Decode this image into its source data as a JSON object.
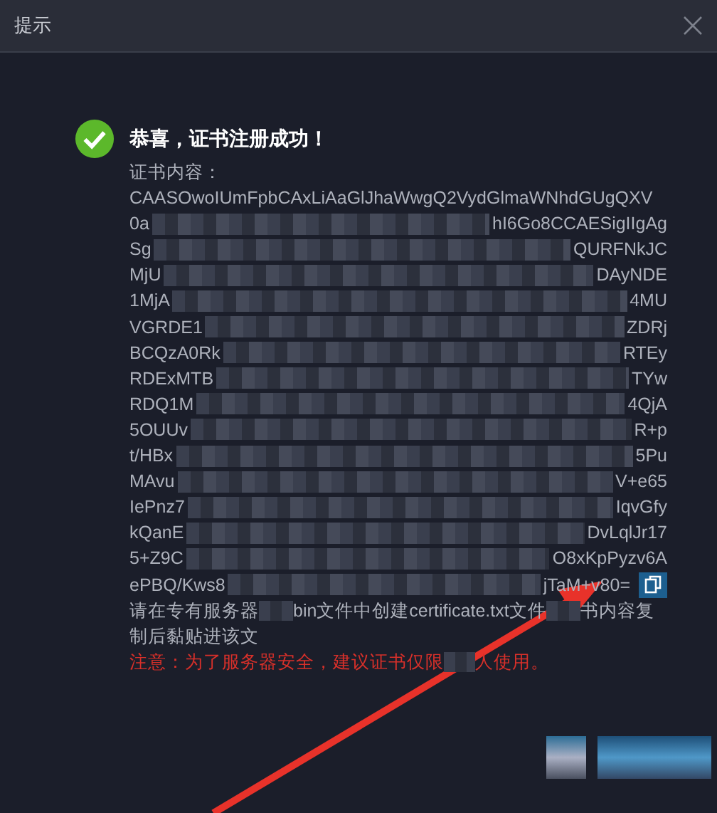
{
  "window": {
    "title": "提示"
  },
  "message": {
    "title": "恭喜，证书注册成功！",
    "label": "证书内容：",
    "certificate_lines": [
      {
        "start": "CAASOwoIUmFpbCAxLiAaGlJhaWwgQ2VydGlmaWNhdGUgQXV"
      },
      {
        "start": "0a",
        "end": "hI6Go8CCAESigIIgAg"
      },
      {
        "start": "Sg",
        "end": "QURFNkJC"
      },
      {
        "start": "MjU",
        "end": "DAyNDE"
      },
      {
        "start": "1MjA",
        "end": "4MU"
      },
      {
        "start": "VGRDE1",
        "end": "ZDRj"
      },
      {
        "start": "BCQzA0Rk",
        "end": "RTEy"
      },
      {
        "start": "RDExMTB",
        "end": "TYw"
      },
      {
        "start": "RDQ1M",
        "end": "4QjA"
      },
      {
        "start": "5OUUv",
        "end": "R+p"
      },
      {
        "start": "t/HBx",
        "end": "5Pu"
      },
      {
        "start": "MAvu",
        "end": "V+e65"
      },
      {
        "start": "IePnz7",
        "end": "IqvGfy"
      },
      {
        "start": "kQanE",
        "end": "DvLqlJr17"
      },
      {
        "start": "5+Z9C",
        "end": "O8xKpPyzv6A"
      },
      {
        "start": "ePBQ/Kws8",
        "end": "jTaM+v80="
      }
    ],
    "instruction": [
      [
        "请在专有服务器",
        "bin文件中创建certificate.txt文件",
        "书内容复"
      ],
      [
        "制后黏贴进该文"
      ]
    ],
    "warning": [
      "注意：为了服务器安全，建议证书仅限",
      "人使用。"
    ]
  }
}
